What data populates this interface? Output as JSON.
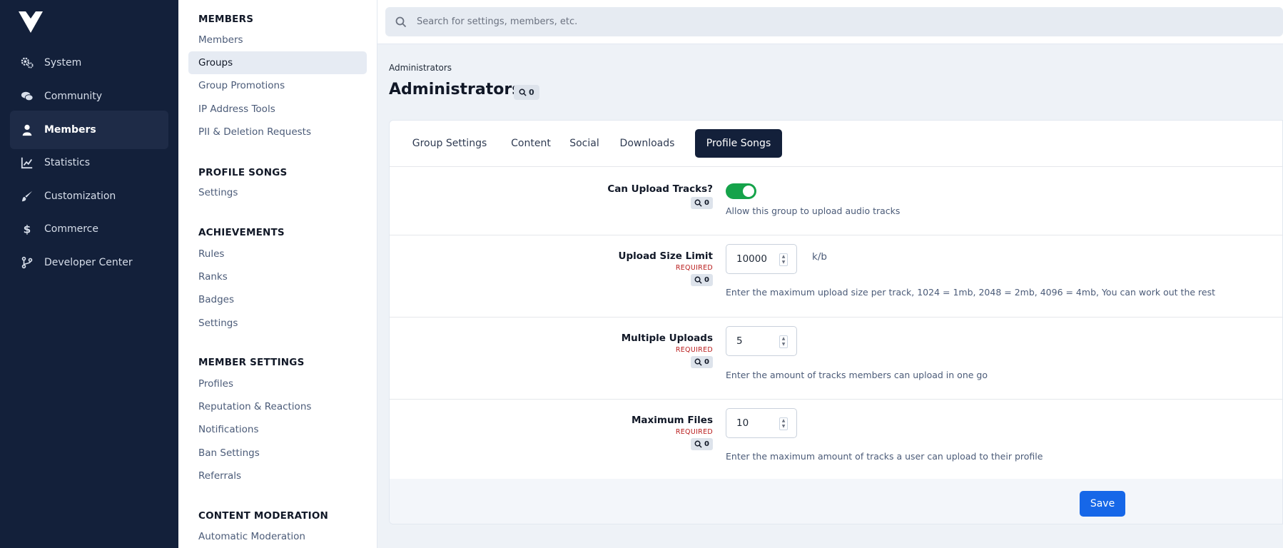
{
  "nav": {
    "items": [
      {
        "label": "System",
        "icon": "cogs-icon"
      },
      {
        "label": "Community",
        "icon": "comments-icon"
      },
      {
        "label": "Members",
        "icon": "user-icon"
      },
      {
        "label": "Statistics",
        "icon": "chart-line-icon"
      },
      {
        "label": "Customization",
        "icon": "paint-brush-icon"
      },
      {
        "label": "Commerce",
        "icon": "dollar-icon"
      },
      {
        "label": "Developer Center",
        "icon": "code-branch-icon"
      }
    ],
    "active": "Members"
  },
  "submenu": {
    "sections": [
      {
        "title": "MEMBERS",
        "items": [
          "Members",
          "Groups",
          "Group Promotions",
          "IP Address Tools",
          "PII & Deletion Requests"
        ]
      },
      {
        "title": "PROFILE SONGS",
        "items": [
          "Settings"
        ]
      },
      {
        "title": "ACHIEVEMENTS",
        "items": [
          "Rules",
          "Ranks",
          "Badges",
          "Settings"
        ]
      },
      {
        "title": "MEMBER SETTINGS",
        "items": [
          "Profiles",
          "Reputation & Reactions",
          "Notifications",
          "Ban Settings",
          "Referrals"
        ]
      },
      {
        "title": "CONTENT MODERATION",
        "items": [
          "Automatic Moderation"
        ]
      }
    ],
    "active": "Groups"
  },
  "search": {
    "placeholder": "Search for settings, members, etc."
  },
  "breadcrumb": "Administrators",
  "page_title": "Administrators",
  "title_badge": "0",
  "tabs": [
    "Group Settings",
    "Content",
    "Social",
    "Downloads",
    "Profile Songs"
  ],
  "active_tab": "Profile Songs",
  "form": {
    "upload_tracks": {
      "label": "Can Upload Tracks?",
      "badge": "0",
      "enabled": true,
      "desc": "Allow this group to upload audio tracks"
    },
    "size_limit": {
      "label": "Upload Size Limit",
      "required": "REQUIRED",
      "badge": "0",
      "value": "10000",
      "unit": "k/b",
      "desc": "Enter the maximum upload size per track, 1024 = 1mb, 2048 = 2mb, 4096 = 4mb, You can work out the rest"
    },
    "multiple_uploads": {
      "label": "Multiple Uploads",
      "required": "REQUIRED",
      "badge": "0",
      "value": "5",
      "desc": "Enter the amount of tracks members can upload in one go"
    },
    "max_files": {
      "label": "Maximum Files",
      "required": "REQUIRED",
      "badge": "0",
      "value": "10",
      "desc": "Enter the maximum amount of tracks a user can upload to their profile"
    }
  },
  "save_label": "Save",
  "colors": {
    "nav_bg": "#13203a",
    "toggle_on": "#15a34a",
    "primary": "#1667e8",
    "required": "#b91c1c"
  }
}
